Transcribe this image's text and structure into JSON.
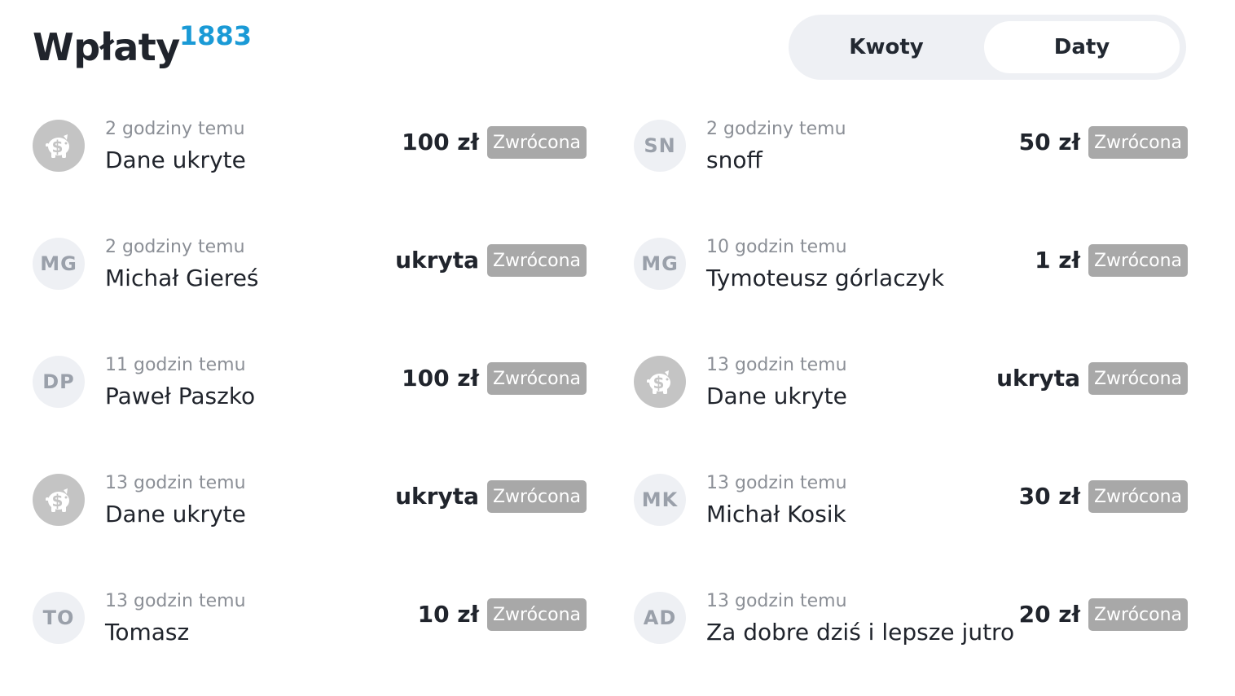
{
  "header": {
    "title": "Wpłaty",
    "count": "1883",
    "toggle": {
      "left_label": "Kwoty",
      "right_label": "Daty",
      "active": "Daty"
    }
  },
  "colors": {
    "accent": "#1a9ad6",
    "badge_bg": "#a8a8a8",
    "avatar_bg": "#eef0f4",
    "anon_avatar_bg": "#c4c4c4"
  },
  "left_column": [
    {
      "avatar": "piggy-bank-icon",
      "initials": "",
      "time": "2 godziny temu",
      "name": "Dane ukryte",
      "amount": "100 zł",
      "status": "Zwrócona"
    },
    {
      "avatar": "initials",
      "initials": "MG",
      "time": "2 godziny temu",
      "name": "Michał Giereś",
      "amount": "ukryta",
      "status": "Zwrócona"
    },
    {
      "avatar": "initials",
      "initials": "DP",
      "time": "11 godzin temu",
      "name": "Paweł Paszko",
      "amount": "100 zł",
      "status": "Zwrócona"
    },
    {
      "avatar": "piggy-bank-icon",
      "initials": "",
      "time": "13 godzin temu",
      "name": "Dane ukryte",
      "amount": "ukryta",
      "status": "Zwrócona"
    },
    {
      "avatar": "initials",
      "initials": "TO",
      "time": "13 godzin temu",
      "name": "Tomasz",
      "amount": "10 zł",
      "status": "Zwrócona"
    }
  ],
  "right_column": [
    {
      "avatar": "initials",
      "initials": "SN",
      "time": "2 godziny temu",
      "name": "snoff",
      "amount": "50 zł",
      "status": "Zwrócona"
    },
    {
      "avatar": "initials",
      "initials": "MG",
      "time": "10 godzin temu",
      "name": "Tymoteusz górlaczyk",
      "amount": "1 zł",
      "status": "Zwrócona"
    },
    {
      "avatar": "piggy-bank-icon",
      "initials": "",
      "time": "13 godzin temu",
      "name": "Dane ukryte",
      "amount": "ukryta",
      "status": "Zwrócona"
    },
    {
      "avatar": "initials",
      "initials": "MK",
      "time": "13 godzin temu",
      "name": "Michał Kosik",
      "amount": "30 zł",
      "status": "Zwrócona"
    },
    {
      "avatar": "initials",
      "initials": "AD",
      "time": "13 godzin temu",
      "name": "Za dobre dziś i lepsze jutro",
      "amount": "20 zł",
      "status": "Zwrócona"
    }
  ]
}
